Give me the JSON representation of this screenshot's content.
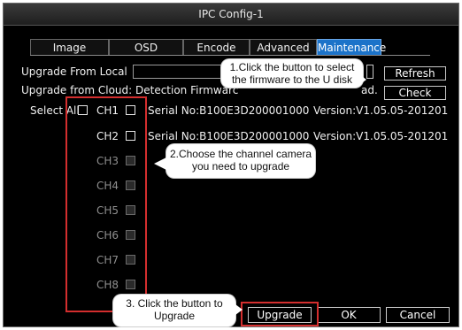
{
  "window": {
    "title": "IPC Config-1"
  },
  "tabs": [
    {
      "label": "Image",
      "active": false
    },
    {
      "label": "OSD",
      "active": false
    },
    {
      "label": "Encode",
      "active": false
    },
    {
      "label": "Advanced",
      "active": false
    },
    {
      "label": "Maintenance",
      "active": true
    }
  ],
  "maintenance": {
    "upgrade_local_label": "Upgrade From Local",
    "refresh_label": "Refresh",
    "upgrade_cloud_label": "Upgrade from Cloud: Detection Firmwarc",
    "upgrade_cloud_tail": "ad.",
    "check_label": "Check",
    "select_all_label": "Select All",
    "channels": [
      {
        "label": "CH1",
        "enabled": true,
        "serial": "Serial No:B100E3D200001000",
        "version": "Version:V1.05.05-201201"
      },
      {
        "label": "CH2",
        "enabled": true,
        "serial": "Serial No:B100E3D200001000",
        "version": "Version:V1.05.05-201201"
      },
      {
        "label": "CH3",
        "enabled": false
      },
      {
        "label": "CH4",
        "enabled": false
      },
      {
        "label": "CH5",
        "enabled": false
      },
      {
        "label": "CH6",
        "enabled": false
      },
      {
        "label": "CH7",
        "enabled": false
      },
      {
        "label": "CH8",
        "enabled": false
      }
    ],
    "upgrade_label": "Upgrade",
    "ok_label": "OK",
    "cancel_label": "Cancel"
  },
  "annotations": {
    "step1": [
      "1.Click the button to select",
      "the firmware to the U disk"
    ],
    "step2": [
      "2.Choose the channel camera",
      "you need to upgrade"
    ],
    "step3": [
      "3. Click the button to",
      "Upgrade"
    ]
  },
  "colors": {
    "accent": "#1c73c9",
    "highlight": "#d42e2e",
    "background": "#000000"
  }
}
